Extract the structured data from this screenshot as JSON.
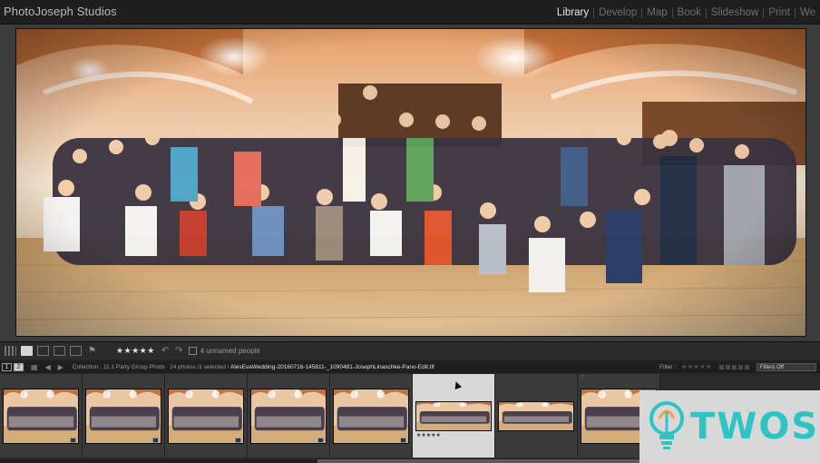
{
  "app": {
    "title": "PhotoJoseph Studios"
  },
  "modules": [
    {
      "label": "Library",
      "active": true
    },
    {
      "label": "Develop",
      "active": false
    },
    {
      "label": "Map",
      "active": false
    },
    {
      "label": "Book",
      "active": false
    },
    {
      "label": "Slideshow",
      "active": false
    },
    {
      "label": "Print",
      "active": false
    },
    {
      "label": "We",
      "active": false
    }
  ],
  "toolbar": {
    "rating": "★★★★★",
    "people_label": "4 unnamed people"
  },
  "filmstrip": {
    "monitor_1": "1",
    "monitor_2": "2",
    "collection": "Collection : 11.1 Party Group Photo",
    "count": "24 photos /1 selected /",
    "filename": "AlesEvaWedding-20160716-145811-_1090481-JosephLinaschke-Pano-Edit.tif",
    "filter_label": "Filter :",
    "filter_stars": "★★★★★",
    "filter_value": "Filters Off",
    "selected_rating": "★★★★★",
    "thumb_number": "7"
  },
  "watermark": {
    "text": "TWOS",
    "colors": {
      "teal": "#2ec4c4",
      "orange": "#f2a33a"
    }
  },
  "colors": {
    "background": "#262626",
    "active_module": "#e6e6e6",
    "inactive_module": "#6e6e6e"
  }
}
